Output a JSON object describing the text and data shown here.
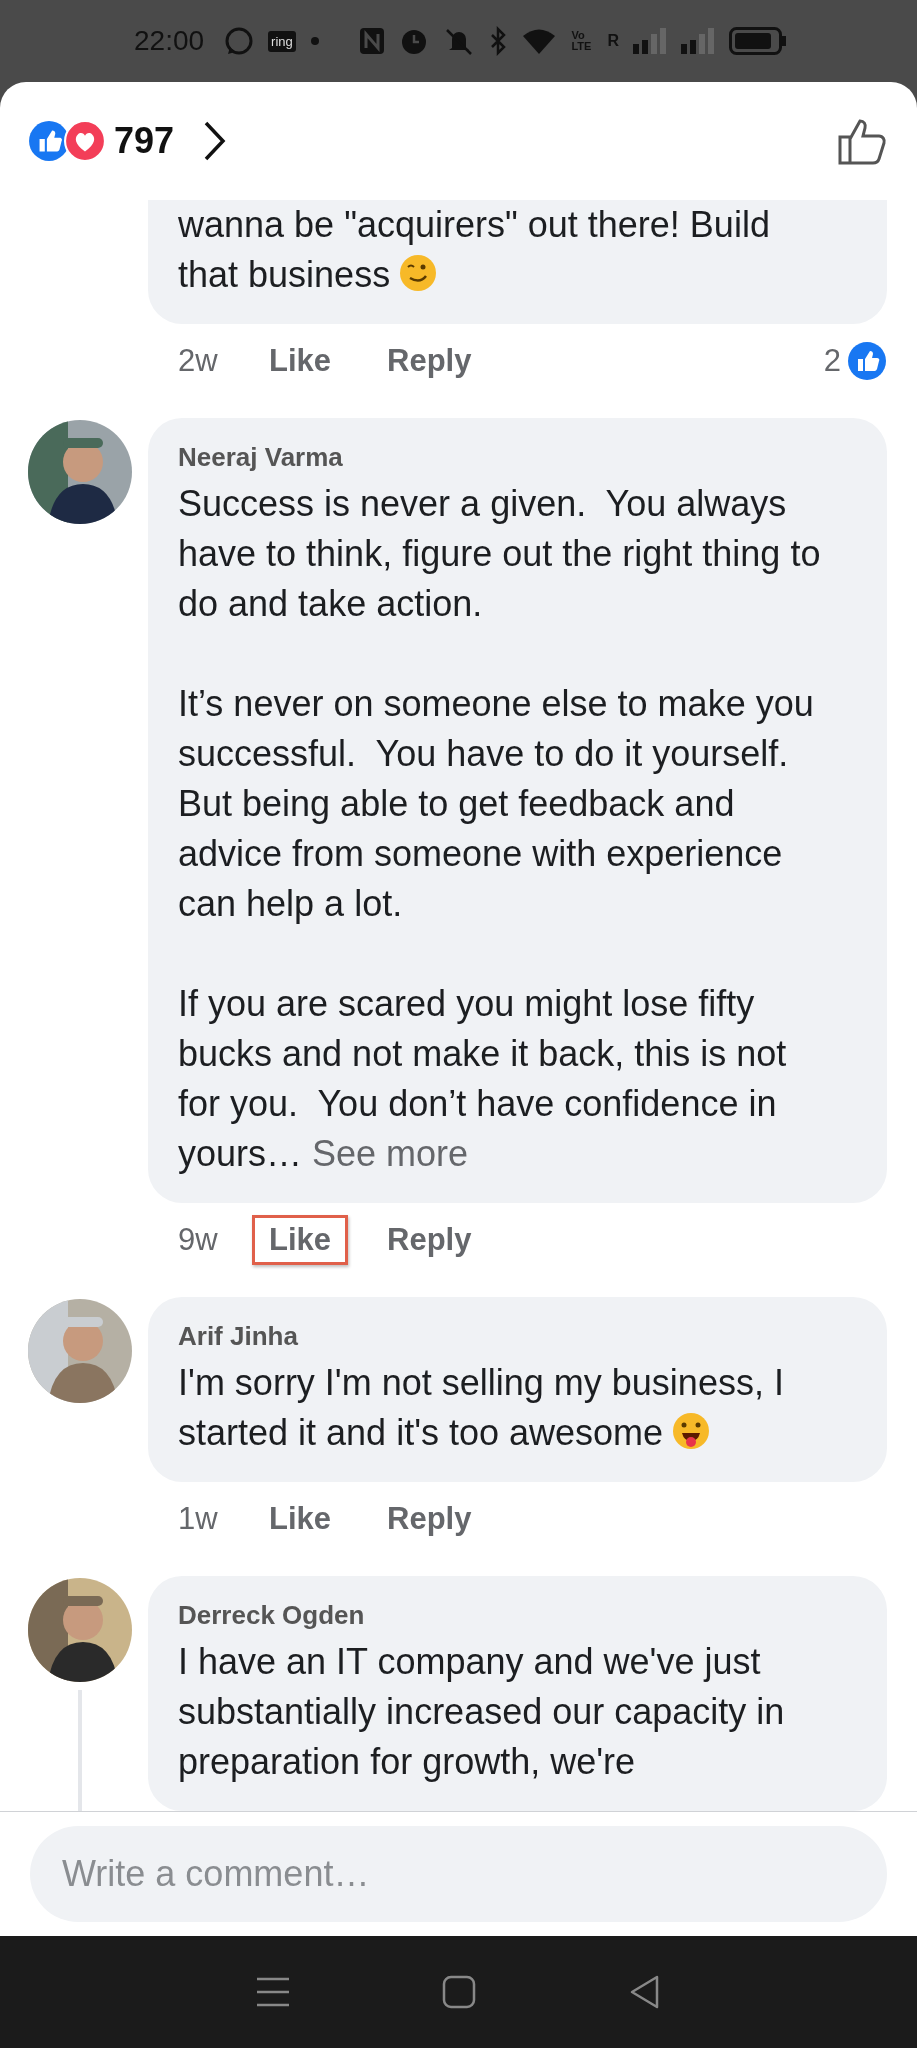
{
  "status_bar": {
    "time": "22:00",
    "ring_badge": "ring",
    "network_label": "Vo LTE",
    "roaming": "R"
  },
  "reactions": {
    "count": "797"
  },
  "comments": [
    {
      "paragraphs": [
        "wanna be \"acquirers\" out there! Build that business"
      ],
      "end_emoji": {
        "kind": "wink"
      },
      "time": "2w",
      "like": "Like",
      "reply": "Reply",
      "like_outlined": false,
      "like_count": "2",
      "has_replies": false,
      "clipped_top": true
    },
    {
      "author": "Neeraj Varma",
      "paragraphs": [
        "Success is never a given.  You always have to think, figure out the right thing to do and take action.",
        "It’s never on someone else to make you successful.  You have to do it yourself.  But being able to get feedback and advice from someone with experience can help a lot.",
        "If you are scared you might lose fifty bucks and not make it back, this is not for you.  You don’t have confidence in yours…"
      ],
      "see_more": "See more",
      "time": "9w",
      "like": "Like",
      "reply": "Reply",
      "like_outlined": true,
      "has_replies": false,
      "clipped_top": false
    },
    {
      "author": "Arif Jinha",
      "paragraphs": [
        "I'm sorry I'm not selling my business, I started it and it's too awesome"
      ],
      "end_emoji": {
        "kind": "tongue"
      },
      "time": "1w",
      "like": "Like",
      "reply": "Reply",
      "like_outlined": false,
      "has_replies": false,
      "clipped_top": false
    },
    {
      "author": "Derreck Ogden",
      "paragraphs": [
        "I have an IT company and we've just substantially increased our capacity in preparation for growth, we're"
      ],
      "has_replies": true,
      "clipped_top": false
    }
  ],
  "composer": {
    "placeholder": "Write a comment…"
  }
}
